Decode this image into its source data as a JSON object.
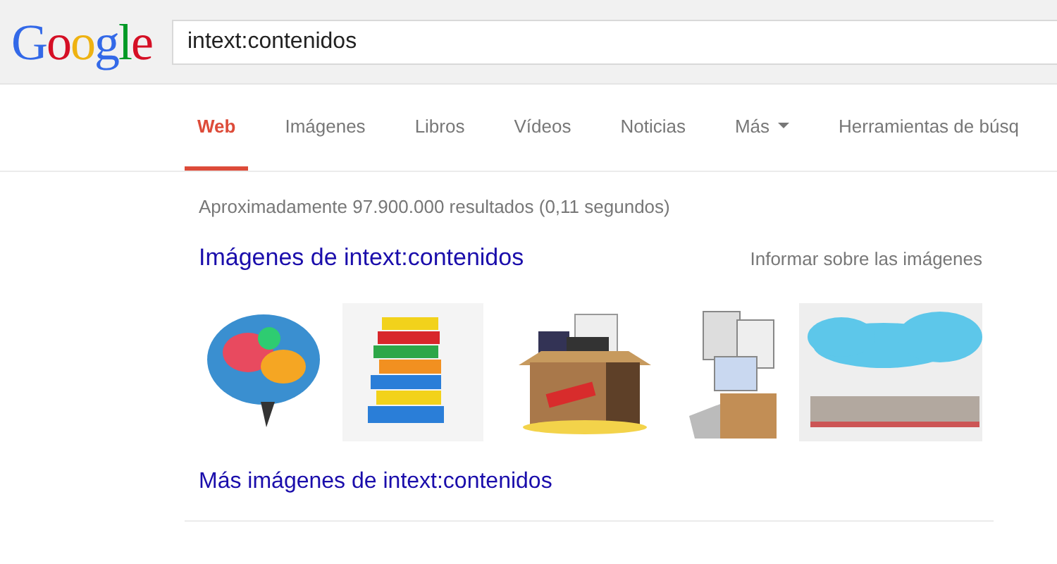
{
  "logo": "Google",
  "search": {
    "value": "intext:contenidos"
  },
  "tabs": [
    {
      "label": "Web",
      "selected": true,
      "dropdown": false
    },
    {
      "label": "Imágenes",
      "selected": false,
      "dropdown": false
    },
    {
      "label": "Libros",
      "selected": false,
      "dropdown": false
    },
    {
      "label": "Vídeos",
      "selected": false,
      "dropdown": false
    },
    {
      "label": "Noticias",
      "selected": false,
      "dropdown": false
    },
    {
      "label": "Más",
      "selected": false,
      "dropdown": true
    },
    {
      "label": "Herramientas de búsq",
      "selected": false,
      "dropdown": false
    }
  ],
  "result_stats": "Aproximadamente 97.900.000 resultados (0,11 segundos)",
  "images_section": {
    "title": "Imágenes de intext:contenidos",
    "report_link": "Informar sobre las imágenes",
    "more_link": "Más imágenes de intext:contenidos"
  }
}
